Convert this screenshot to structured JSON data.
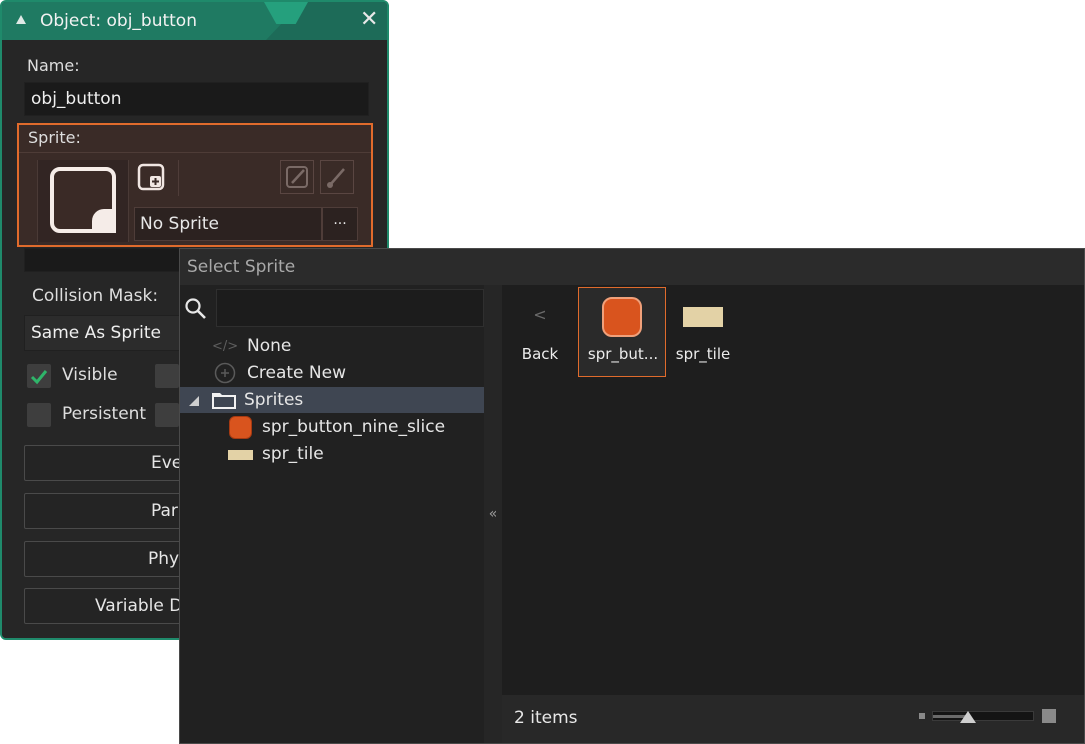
{
  "object_window": {
    "title": "Object: obj_button",
    "close_glyph": "✕",
    "name_label": "Name:",
    "name_value": "obj_button",
    "sprite_label": "Sprite:",
    "sprite_value": "No Sprite",
    "sprite_more": "···",
    "collision_label": "Collision Mask:",
    "collision_value": "Same As Sprite",
    "visible_label": "Visible",
    "visible_checked": true,
    "persistent_label": "Persistent",
    "persistent_checked": false,
    "buttons": [
      "Eve",
      "Par",
      "Phy",
      "Variable D"
    ]
  },
  "select_sprite": {
    "title": "Select Sprite",
    "search_placeholder": "",
    "tree": [
      {
        "label": "None",
        "icon": "code-icon"
      },
      {
        "label": "Create New",
        "icon": "plus-circle-icon"
      },
      {
        "label": "Sprites",
        "icon": "folder-icon",
        "selected": true
      },
      {
        "label": "spr_button_nine_slice",
        "icon": "orange-sprite-icon"
      },
      {
        "label": "spr_tile",
        "icon": "tile-sprite-icon"
      }
    ],
    "collapse_glyph": "«",
    "assets": [
      {
        "label": "Back",
        "glyph": "<"
      },
      {
        "label": "spr_but...",
        "selected": true
      },
      {
        "label": "spr_tile"
      }
    ],
    "status": "2 items"
  },
  "colors": {
    "accent_teal": "#1f8a6b",
    "highlight_orange": "#e06b2c",
    "sprite_orange": "#d9541e",
    "tile_tan": "#e3d2a6"
  }
}
